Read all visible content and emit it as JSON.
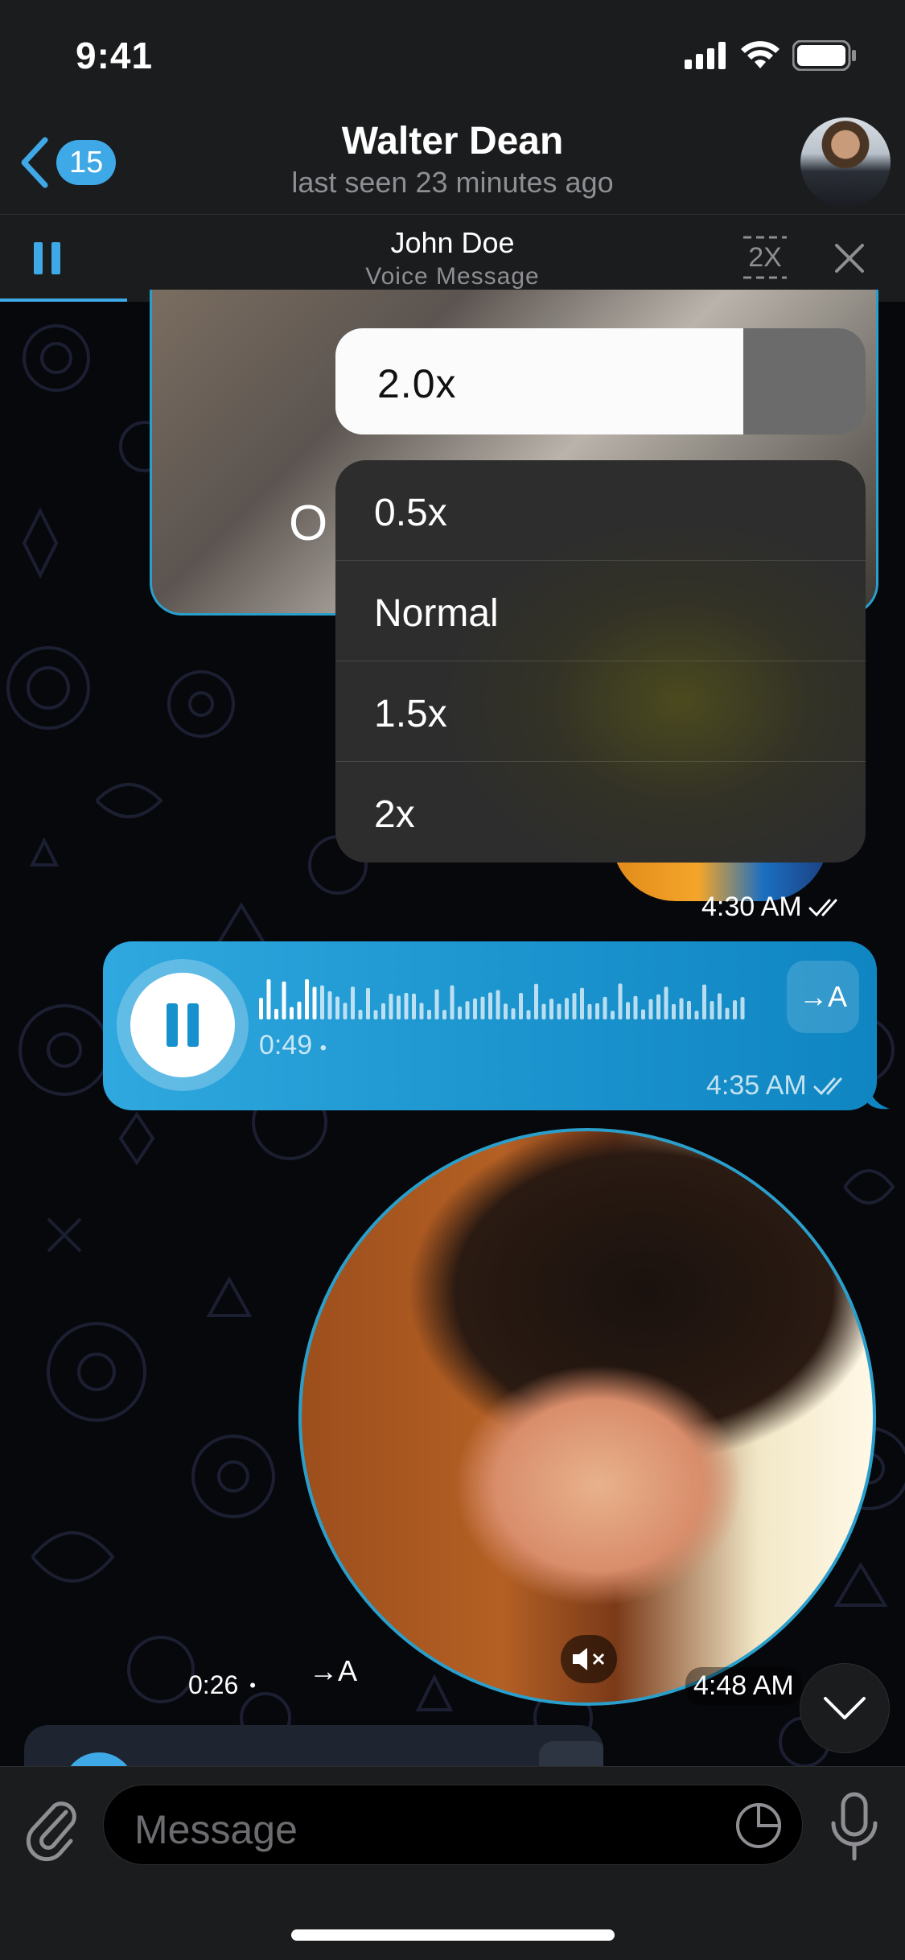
{
  "status_bar": {
    "time": "9:41"
  },
  "header": {
    "back_badge": "15",
    "title": "Walter Dean",
    "subtitle": "last seen 23 minutes ago"
  },
  "player": {
    "name": "John Doe",
    "subtitle": "Voice Message",
    "speed_label": "2X",
    "progress_fraction": 0.14
  },
  "speed_menu": {
    "current": "2.0x",
    "current_fill_fraction": 0.77,
    "options": [
      "0.5x",
      "Normal",
      "1.5x",
      "2x"
    ]
  },
  "messages": {
    "top_video_letter": "O",
    "circle_video_time": "4:30 AM",
    "voice": {
      "duration": "0:49",
      "time": "4:35 AM",
      "translate": "→A"
    },
    "video_note": {
      "duration": "0:26",
      "translate": "→A",
      "time": "4:48 AM"
    }
  },
  "composer": {
    "placeholder": "Message"
  },
  "colors": {
    "accent": "#3ea9e6",
    "bubble_out": "#1d95cf",
    "bar_bg": "#1b1c1e"
  },
  "icons": [
    "back-chevron-icon",
    "signal-icon",
    "wifi-icon",
    "battery-icon",
    "pause-icon",
    "speed-icon",
    "close-icon",
    "translate-icon",
    "mute-icon",
    "chevron-down-icon",
    "attach-icon",
    "sticker-icon",
    "mic-icon",
    "double-check-icon"
  ]
}
